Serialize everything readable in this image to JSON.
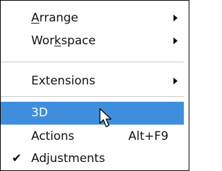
{
  "menu": {
    "items": [
      {
        "pre": "",
        "accel": "A",
        "post": "rrange",
        "submenu": true
      },
      {
        "pre": "Wor",
        "accel": "k",
        "post": "space",
        "submenu": true
      },
      {
        "label": "Extensions",
        "submenu": true
      },
      {
        "label": "3D",
        "highlighted": true,
        "submenu": false
      },
      {
        "label": "Actions",
        "shortcut": "Alt+F9"
      },
      {
        "label": "Adjustments",
        "checked": true,
        "check_glyph": "✔"
      }
    ],
    "highlight_color": "#3f8edd",
    "icons": {
      "submenu": "submenu-arrow-icon",
      "check": "checkmark-icon",
      "cursor": "mouse-pointer-icon"
    }
  }
}
